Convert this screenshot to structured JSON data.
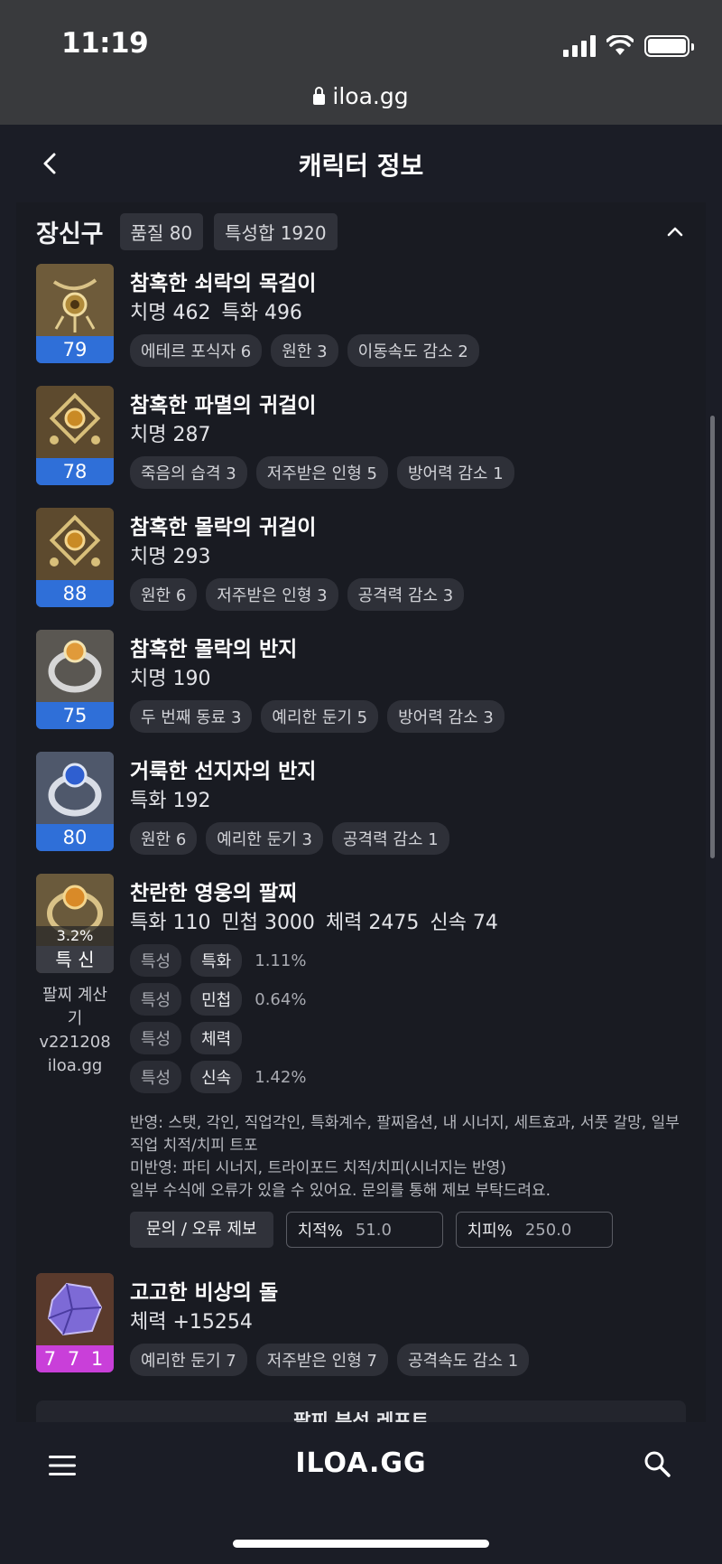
{
  "status": {
    "time": "11:19",
    "url": "iloa.gg"
  },
  "header": {
    "title": "캐릭터 정보"
  },
  "section": {
    "title": "장신구",
    "chips": [
      "품질 80",
      "특성합 1920"
    ]
  },
  "items": [
    {
      "quality": "79",
      "name": "참혹한 쇠락의 목걸이",
      "stats": [
        "치명 462",
        "특화 496"
      ],
      "tags": [
        "에테르 포식자 6",
        "원한 3",
        "이동속도 감소 2"
      ]
    },
    {
      "quality": "78",
      "name": "참혹한 파멸의 귀걸이",
      "stats": [
        "치명 287"
      ],
      "tags": [
        "죽음의 습격 3",
        "저주받은 인형 5",
        "방어력 감소 1"
      ]
    },
    {
      "quality": "88",
      "name": "참혹한 몰락의 귀걸이",
      "stats": [
        "치명 293"
      ],
      "tags": [
        "원한 6",
        "저주받은 인형 3",
        "공격력 감소 3"
      ]
    },
    {
      "quality": "75",
      "name": "참혹한 몰락의 반지",
      "stats": [
        "치명 190"
      ],
      "tags": [
        "두 번째 동료 3",
        "예리한 둔기 5",
        "방어력 감소 3"
      ]
    },
    {
      "quality": "80",
      "name": "거룩한 선지자의 반지",
      "stats": [
        "특화 192"
      ],
      "tags": [
        "원한 6",
        "예리한 둔기 3",
        "공격력 감소 1"
      ]
    }
  ],
  "bracelet": {
    "pct": "3.2%",
    "sub": "특 신",
    "calc": [
      "팔찌 계산기",
      "v221208",
      "iloa.gg"
    ],
    "name": "찬란한 영웅의 팔찌",
    "stats": [
      "특화 110",
      "민첩 3000",
      "체력 2475",
      "신속 74"
    ],
    "traits": [
      {
        "key": "특성",
        "val": "특화",
        "pct": "1.11%"
      },
      {
        "key": "특성",
        "val": "민첩",
        "pct": "0.64%"
      },
      {
        "key": "특성",
        "val": "체력",
        "pct": ""
      },
      {
        "key": "특성",
        "val": "신속",
        "pct": "1.42%"
      }
    ],
    "note1": "반영: 스탯, 각인, 직업각인, 특화계수, 팔찌옵션, 내 시너지, 세트효과, 서풋 갈망, 일부 직업 치적/치피 트포",
    "note2": "미반영: 파티 시너지, 트라이포드 치적/치피(시너지는 반영)",
    "note3": "일부 수식에 오류가 있을 수 있어요. 문의를 통해 제보 부탁드려요.",
    "button": "문의 / 오류 제보",
    "crit_rate_label": "치적%",
    "crit_rate_value": "51.0",
    "crit_dmg_label": "치피%",
    "crit_dmg_value": "250.0"
  },
  "stone": {
    "quality": "7 7 1",
    "name": "고고한 비상의 돌",
    "stats": [
      "체력 +15254"
    ],
    "tags": [
      "예리한 둔기 7",
      "저주받은 인형 7",
      "공격속도 감소 1"
    ]
  },
  "report": "팔찌 분석 레포트",
  "bottom": {
    "logo": "ILOA.GG"
  },
  "colors": {
    "quality_blue": "#2f6fd8",
    "stone_purple": "#c93fd9",
    "background": "#1b1d26"
  }
}
